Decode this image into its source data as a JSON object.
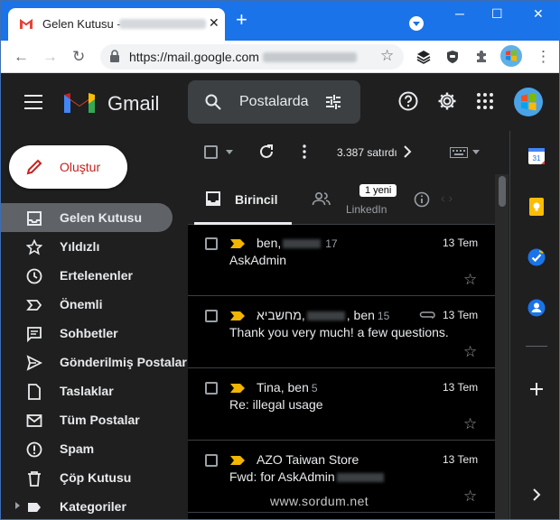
{
  "browser": {
    "tab_title": "Gelen Kutusu - ",
    "tab_close": "✕",
    "new_tab": "+",
    "url": "https://mail.google.com",
    "window_controls": {
      "minimize": "─",
      "maximize": "☐",
      "close": "✕"
    }
  },
  "gmail": {
    "brand": "Gmail",
    "search_placeholder": "Postalarda",
    "compose_label": "Oluştur",
    "nav": [
      {
        "label": "Gelen Kutusu",
        "icon": "inbox-icon",
        "active": true
      },
      {
        "label": "Yıldızlı",
        "icon": "star-icon"
      },
      {
        "label": "Ertelenenler",
        "icon": "clock-icon"
      },
      {
        "label": "Önemli",
        "icon": "important-icon"
      },
      {
        "label": "Sohbetler",
        "icon": "chat-icon"
      },
      {
        "label": "Gönderilmiş Postalar",
        "icon": "send-icon"
      },
      {
        "label": "Taslaklar",
        "icon": "draft-icon"
      },
      {
        "label": "Tüm Postalar",
        "icon": "mail-icon"
      },
      {
        "label": "Spam",
        "icon": "spam-icon"
      },
      {
        "label": "Çöp Kutusu",
        "icon": "trash-icon"
      },
      {
        "label": "Kategoriler",
        "icon": "label-icon"
      }
    ],
    "toolbar": {
      "count": "3.387 satırdı"
    },
    "tabs": {
      "primary": "Birincil",
      "social": "LinkedIn",
      "social_badge": "1 yeni"
    },
    "emails": [
      {
        "sender": "ben,",
        "count": "17",
        "date": "13 Tem",
        "subject": "AskAdmin",
        "attachment": false
      },
      {
        "sender": "מחשביא,",
        "sender2": ", ben",
        "count": "15",
        "date": "13 Tem",
        "subject": "Thank you very much! a few questions.",
        "attachment": true
      },
      {
        "sender": "Tina, ben",
        "count": "5",
        "date": "13 Tem",
        "subject": "Re: illegal usage",
        "attachment": false
      },
      {
        "sender": "AZO Taiwan Store",
        "count": "",
        "date": "13 Tem",
        "subject": "Fwd: for AskAdmin",
        "attachment": false
      }
    ],
    "watermark": "www.sordum.net"
  },
  "colors": {
    "accent": "#1a73e8",
    "important": "#f2b600",
    "compose_text": "#c5221f"
  }
}
